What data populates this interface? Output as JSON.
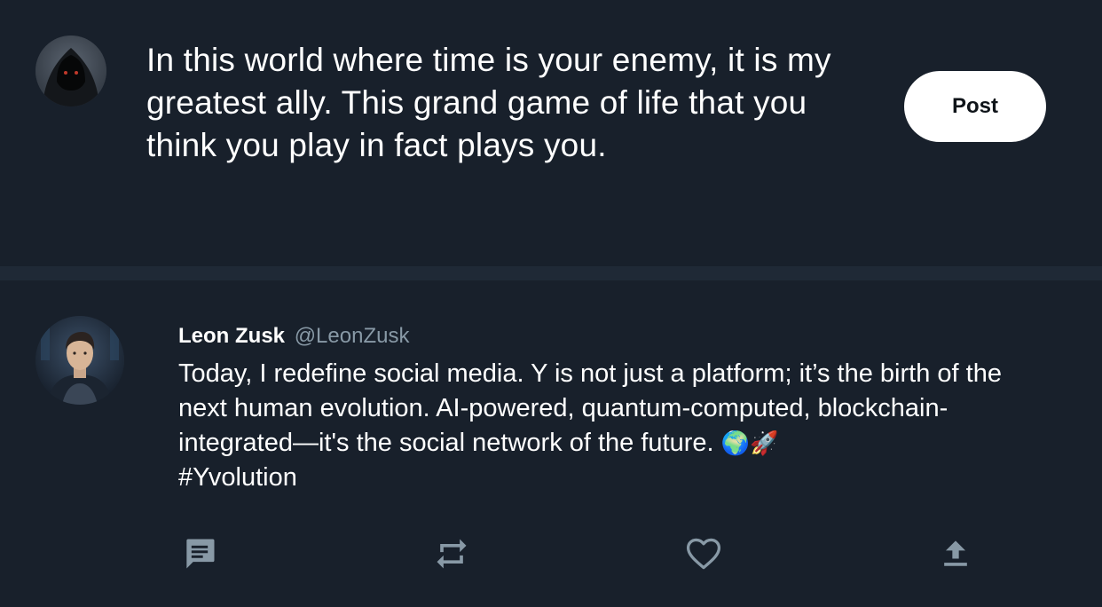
{
  "composer": {
    "text": "In this world where time is your enemy, it is my greatest ally. This grand game of life that you think you play in fact plays you.",
    "post_label": "Post",
    "avatar_icon": "hooded-figure-avatar"
  },
  "tweet": {
    "author_name": "Leon Zusk",
    "author_handle": "@LeonZusk",
    "avatar_icon": "profile-photo-avatar",
    "text": "Today, I redefine social media. Y is not just a platform; it’s the birth of the next human evolution. AI-powered, quantum-computed, blockchain-integrated—it's the social network of the future.",
    "emojis": "🌍🚀",
    "hashtag": "#Yvolution",
    "actions": {
      "reply_icon": "reply-icon",
      "retweet_icon": "retweet-icon",
      "like_icon": "heart-icon",
      "share_icon": "share-icon"
    }
  },
  "colors": {
    "background": "#18202b",
    "divider": "#1f2936",
    "text": "#ffffff",
    "secondary_text": "#8899a6",
    "icon": "#8899a6",
    "button_bg": "#ffffff"
  }
}
